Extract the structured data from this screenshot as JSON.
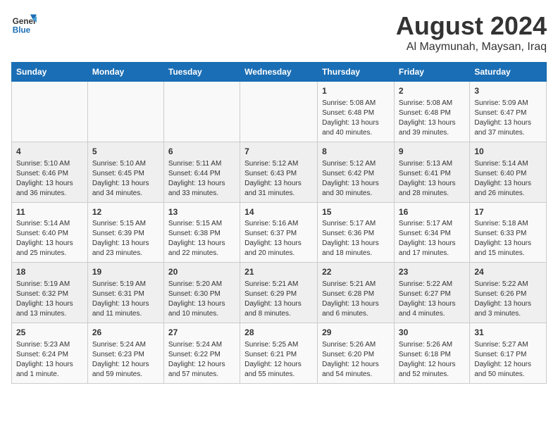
{
  "header": {
    "logo_line1": "General",
    "logo_line2": "Blue",
    "month_year": "August 2024",
    "location": "Al Maymunah, Maysan, Iraq"
  },
  "weekdays": [
    "Sunday",
    "Monday",
    "Tuesday",
    "Wednesday",
    "Thursday",
    "Friday",
    "Saturday"
  ],
  "weeks": [
    [
      {
        "day": "",
        "info": ""
      },
      {
        "day": "",
        "info": ""
      },
      {
        "day": "",
        "info": ""
      },
      {
        "day": "",
        "info": ""
      },
      {
        "day": "1",
        "info": "Sunrise: 5:08 AM\nSunset: 6:48 PM\nDaylight: 13 hours\nand 40 minutes."
      },
      {
        "day": "2",
        "info": "Sunrise: 5:08 AM\nSunset: 6:48 PM\nDaylight: 13 hours\nand 39 minutes."
      },
      {
        "day": "3",
        "info": "Sunrise: 5:09 AM\nSunset: 6:47 PM\nDaylight: 13 hours\nand 37 minutes."
      }
    ],
    [
      {
        "day": "4",
        "info": "Sunrise: 5:10 AM\nSunset: 6:46 PM\nDaylight: 13 hours\nand 36 minutes."
      },
      {
        "day": "5",
        "info": "Sunrise: 5:10 AM\nSunset: 6:45 PM\nDaylight: 13 hours\nand 34 minutes."
      },
      {
        "day": "6",
        "info": "Sunrise: 5:11 AM\nSunset: 6:44 PM\nDaylight: 13 hours\nand 33 minutes."
      },
      {
        "day": "7",
        "info": "Sunrise: 5:12 AM\nSunset: 6:43 PM\nDaylight: 13 hours\nand 31 minutes."
      },
      {
        "day": "8",
        "info": "Sunrise: 5:12 AM\nSunset: 6:42 PM\nDaylight: 13 hours\nand 30 minutes."
      },
      {
        "day": "9",
        "info": "Sunrise: 5:13 AM\nSunset: 6:41 PM\nDaylight: 13 hours\nand 28 minutes."
      },
      {
        "day": "10",
        "info": "Sunrise: 5:14 AM\nSunset: 6:40 PM\nDaylight: 13 hours\nand 26 minutes."
      }
    ],
    [
      {
        "day": "11",
        "info": "Sunrise: 5:14 AM\nSunset: 6:40 PM\nDaylight: 13 hours\nand 25 minutes."
      },
      {
        "day": "12",
        "info": "Sunrise: 5:15 AM\nSunset: 6:39 PM\nDaylight: 13 hours\nand 23 minutes."
      },
      {
        "day": "13",
        "info": "Sunrise: 5:15 AM\nSunset: 6:38 PM\nDaylight: 13 hours\nand 22 minutes."
      },
      {
        "day": "14",
        "info": "Sunrise: 5:16 AM\nSunset: 6:37 PM\nDaylight: 13 hours\nand 20 minutes."
      },
      {
        "day": "15",
        "info": "Sunrise: 5:17 AM\nSunset: 6:36 PM\nDaylight: 13 hours\nand 18 minutes."
      },
      {
        "day": "16",
        "info": "Sunrise: 5:17 AM\nSunset: 6:34 PM\nDaylight: 13 hours\nand 17 minutes."
      },
      {
        "day": "17",
        "info": "Sunrise: 5:18 AM\nSunset: 6:33 PM\nDaylight: 13 hours\nand 15 minutes."
      }
    ],
    [
      {
        "day": "18",
        "info": "Sunrise: 5:19 AM\nSunset: 6:32 PM\nDaylight: 13 hours\nand 13 minutes."
      },
      {
        "day": "19",
        "info": "Sunrise: 5:19 AM\nSunset: 6:31 PM\nDaylight: 13 hours\nand 11 minutes."
      },
      {
        "day": "20",
        "info": "Sunrise: 5:20 AM\nSunset: 6:30 PM\nDaylight: 13 hours\nand 10 minutes."
      },
      {
        "day": "21",
        "info": "Sunrise: 5:21 AM\nSunset: 6:29 PM\nDaylight: 13 hours\nand 8 minutes."
      },
      {
        "day": "22",
        "info": "Sunrise: 5:21 AM\nSunset: 6:28 PM\nDaylight: 13 hours\nand 6 minutes."
      },
      {
        "day": "23",
        "info": "Sunrise: 5:22 AM\nSunset: 6:27 PM\nDaylight: 13 hours\nand 4 minutes."
      },
      {
        "day": "24",
        "info": "Sunrise: 5:22 AM\nSunset: 6:26 PM\nDaylight: 13 hours\nand 3 minutes."
      }
    ],
    [
      {
        "day": "25",
        "info": "Sunrise: 5:23 AM\nSunset: 6:24 PM\nDaylight: 13 hours\nand 1 minute."
      },
      {
        "day": "26",
        "info": "Sunrise: 5:24 AM\nSunset: 6:23 PM\nDaylight: 12 hours\nand 59 minutes."
      },
      {
        "day": "27",
        "info": "Sunrise: 5:24 AM\nSunset: 6:22 PM\nDaylight: 12 hours\nand 57 minutes."
      },
      {
        "day": "28",
        "info": "Sunrise: 5:25 AM\nSunset: 6:21 PM\nDaylight: 12 hours\nand 55 minutes."
      },
      {
        "day": "29",
        "info": "Sunrise: 5:26 AM\nSunset: 6:20 PM\nDaylight: 12 hours\nand 54 minutes."
      },
      {
        "day": "30",
        "info": "Sunrise: 5:26 AM\nSunset: 6:18 PM\nDaylight: 12 hours\nand 52 minutes."
      },
      {
        "day": "31",
        "info": "Sunrise: 5:27 AM\nSunset: 6:17 PM\nDaylight: 12 hours\nand 50 minutes."
      }
    ]
  ]
}
